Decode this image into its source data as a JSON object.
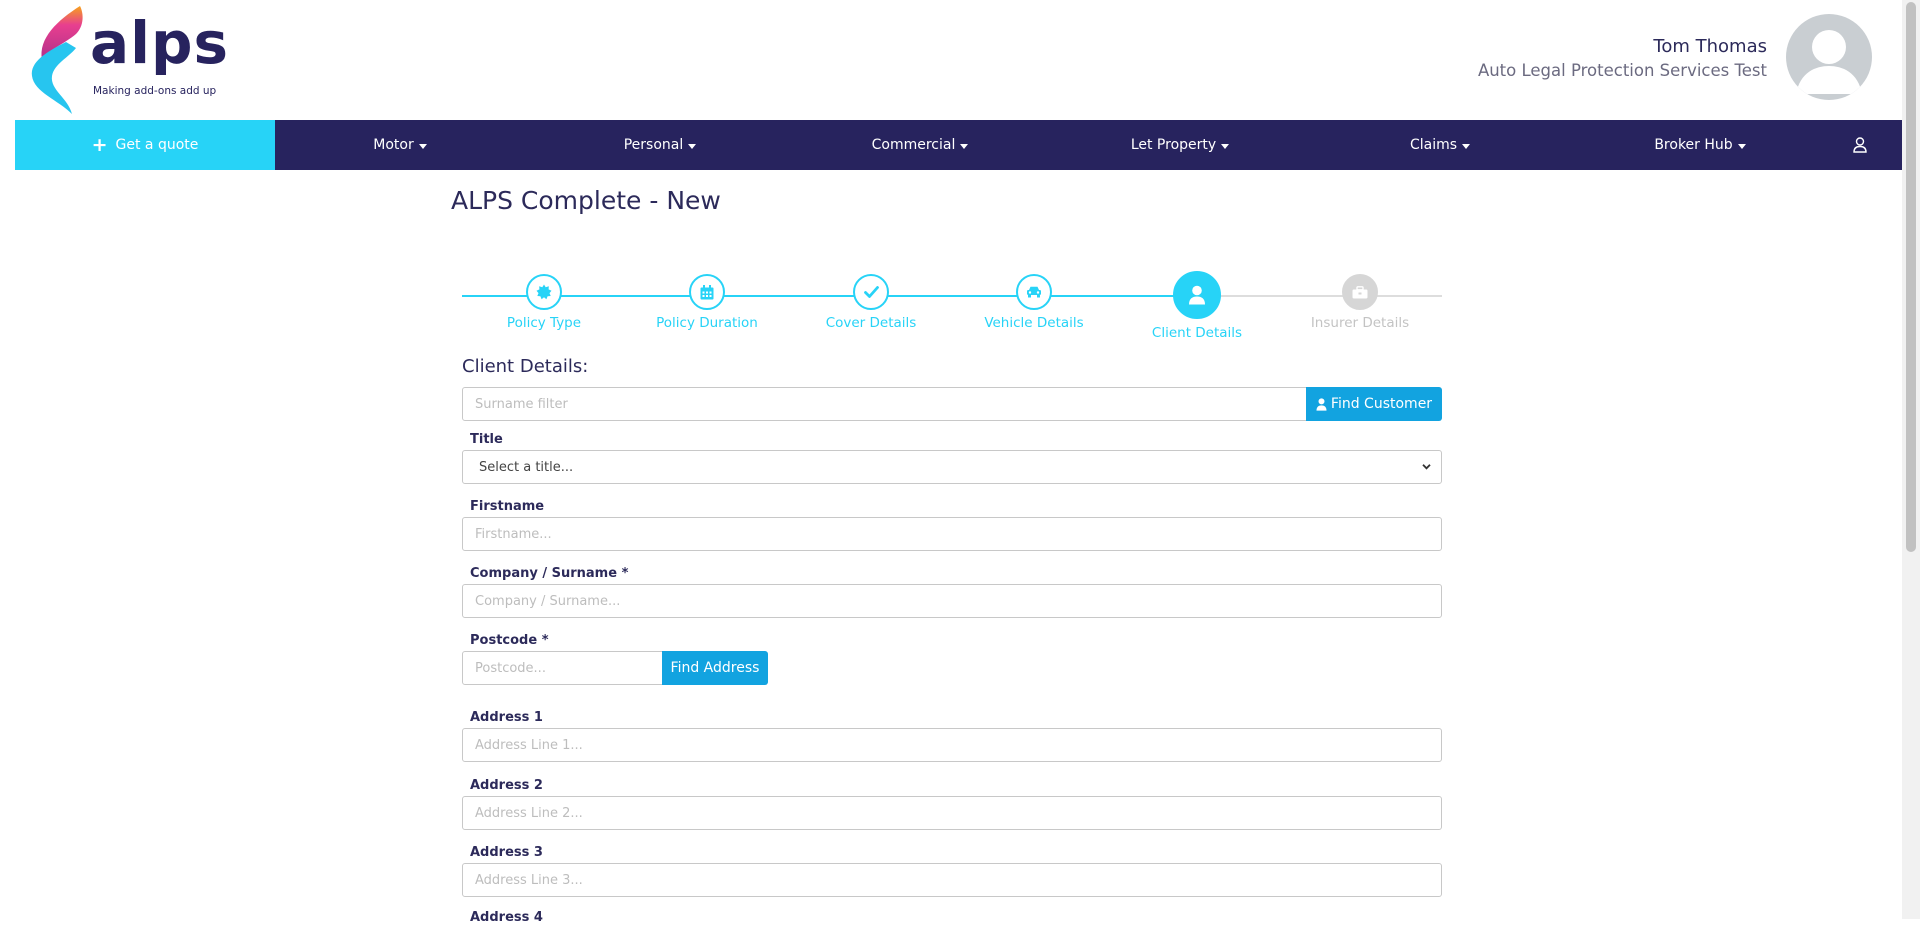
{
  "brand": {
    "logo_word": "alps",
    "tagline": "Making add-ons add up"
  },
  "user": {
    "name": "Tom Thomas",
    "company": "Auto Legal Protection Services Test"
  },
  "nav": {
    "quote_label": "Get a quote",
    "items": [
      {
        "label": "Motor"
      },
      {
        "label": "Personal"
      },
      {
        "label": "Commercial"
      },
      {
        "label": "Let Property"
      },
      {
        "label": "Claims"
      },
      {
        "label": "Broker Hub"
      }
    ]
  },
  "page": {
    "title": "ALPS Complete - New"
  },
  "steps": [
    {
      "label": "Policy Type",
      "icon": "certificate-icon",
      "state": "done"
    },
    {
      "label": "Policy Duration",
      "icon": "calendar-icon",
      "state": "done"
    },
    {
      "label": "Cover Details",
      "icon": "check-icon",
      "state": "done"
    },
    {
      "label": "Vehicle Details",
      "icon": "car-icon",
      "state": "done"
    },
    {
      "label": "Client Details",
      "icon": "user-icon",
      "state": "active"
    },
    {
      "label": "Insurer Details",
      "icon": "briefcase-icon",
      "state": "pending"
    }
  ],
  "form": {
    "section_title": "Client Details:",
    "surname_filter_placeholder": "Surname filter",
    "find_customer_label": "Find Customer",
    "title_label": "Title",
    "title_value": "Select a title...",
    "firstname_label": "Firstname",
    "firstname_placeholder": "Firstname...",
    "surname_label": "Company / Surname *",
    "surname_placeholder": "Company / Surname...",
    "postcode_label": "Postcode *",
    "postcode_placeholder": "Postcode...",
    "find_address_label": "Find Address",
    "address1_label": "Address 1",
    "address1_placeholder": "Address Line 1...",
    "address2_label": "Address 2",
    "address2_placeholder": "Address Line 2...",
    "address3_label": "Address 3",
    "address3_placeholder": "Address Line 3...",
    "address4_label": "Address 4"
  },
  "colors": {
    "navy": "#27235e",
    "cyan": "#27d3f7",
    "button_blue": "#12a3e0"
  }
}
